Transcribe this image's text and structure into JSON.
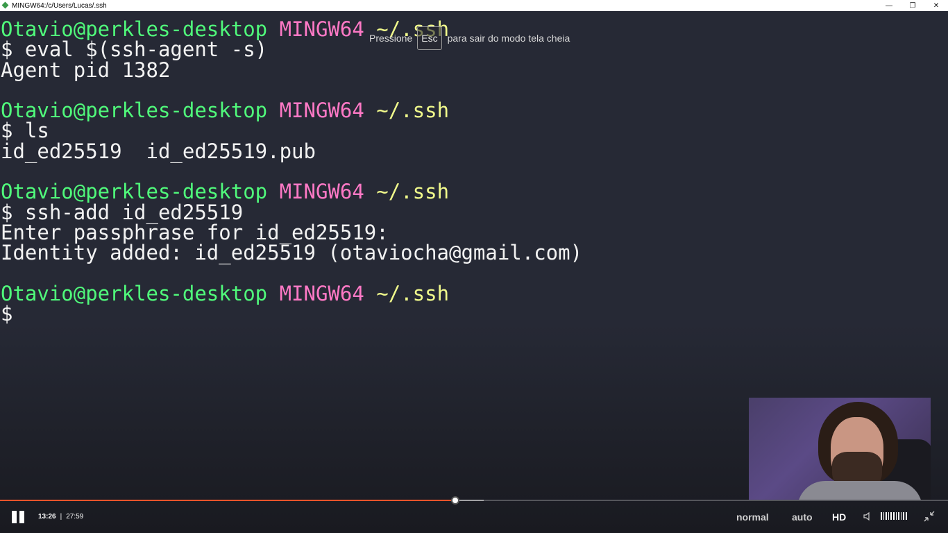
{
  "window": {
    "title": "MINGW64:/c/Users/Lucas/.ssh",
    "minimize_glyph": "—",
    "restore_glyph": "❐",
    "close_glyph": "✕"
  },
  "terminal": {
    "lines": [
      {
        "user": "Otavio@perkles-desktop",
        "sys": "MINGW64",
        "path": "~/.ssh"
      },
      {
        "text": "$ eval $(ssh-agent -s)"
      },
      {
        "text": "Agent pid 1382"
      },
      {
        "text": ""
      },
      {
        "user": "Otavio@perkles-desktop",
        "sys": "MINGW64",
        "path": "~/.ssh"
      },
      {
        "text": "$ ls"
      },
      {
        "text": "id_ed25519  id_ed25519.pub"
      },
      {
        "text": ""
      },
      {
        "user": "Otavio@perkles-desktop",
        "sys": "MINGW64",
        "path": "~/.ssh"
      },
      {
        "text": "$ ssh-add id_ed25519"
      },
      {
        "text": "Enter passphrase for id_ed25519:"
      },
      {
        "text": "Identity added: id_ed25519 (otaviocha@gmail.com)"
      },
      {
        "text": ""
      },
      {
        "user": "Otavio@perkles-desktop",
        "sys": "MINGW64",
        "path": "~/.ssh"
      },
      {
        "text": "$"
      }
    ],
    "colors": {
      "user": "#50fa7b",
      "sys": "#ff79c6",
      "path": "#f1fa8c"
    }
  },
  "toast": {
    "prefix": "Pressione",
    "key": "Esc",
    "suffix": "para sair do modo tela cheia"
  },
  "player": {
    "current_time": "13:26",
    "separator": "|",
    "duration": "27:59",
    "progress_fraction": 0.48,
    "buffered_fraction": 0.51,
    "speed_label": "normal",
    "quality_label": "auto",
    "hd_label": "HD",
    "volume_level": 1.0,
    "icons": {
      "pause": "pause-icon",
      "volume": "volume-icon",
      "exit_fullscreen": "exit-fullscreen-icon"
    },
    "played_color": "#e8542a"
  }
}
